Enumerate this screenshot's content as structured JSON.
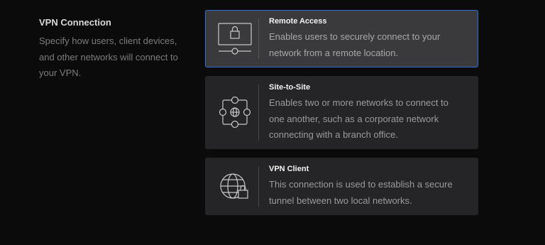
{
  "section": {
    "title": "VPN Connection",
    "description": "Specify how users, client devices, and other networks will connect to your VPN."
  },
  "options": [
    {
      "title": "Remote Access",
      "description": "Enables users to securely connect to your network from a remote location.",
      "icon": "remote-access-icon",
      "selected": true
    },
    {
      "title": "Site-to-Site",
      "description": "Enables two or more networks to connect to one another, such as a corporate network connecting with a branch office.",
      "icon": "site-to-site-icon",
      "selected": false
    },
    {
      "title": "VPN Client",
      "description": "This connection is used to establish a secure tunnel between two local networks.",
      "icon": "vpn-client-icon",
      "selected": false
    }
  ],
  "colors": {
    "background": "#0b0b0c",
    "card": "#252527",
    "card_selected": "#3a3a3c",
    "accent": "#2f6fd6",
    "icon_stroke": "#c8c8c8"
  }
}
